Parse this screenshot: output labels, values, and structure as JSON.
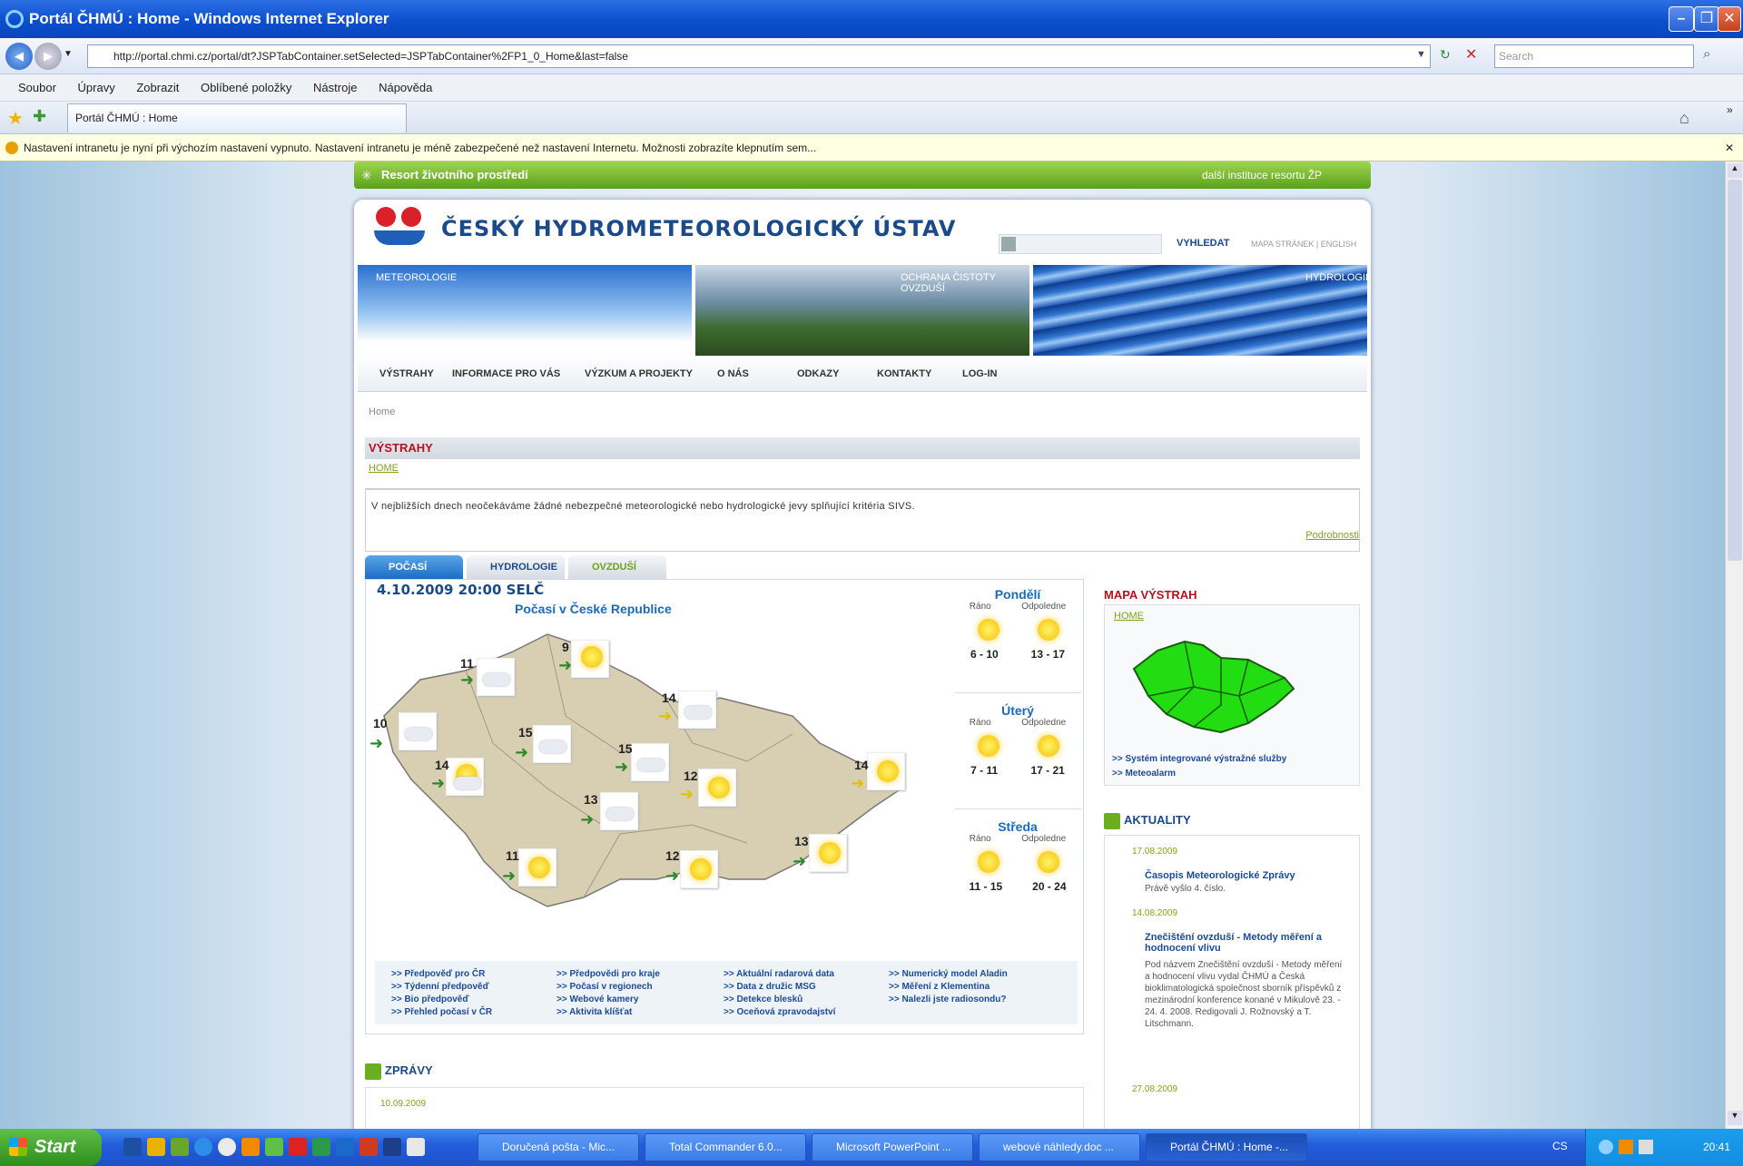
{
  "window": {
    "title": "Portál ČHMÚ : Home - Windows Internet Explorer"
  },
  "addressbar": {
    "url": "http://portal.chmi.cz/portal/dt?JSPTabContainer.setSelected=JSPTabContainer%2FP1_0_Home&last=false",
    "search_placeholder": "Search"
  },
  "menu": [
    "Soubor",
    "Úpravy",
    "Zobrazit",
    "Oblíbené položky",
    "Nástroje",
    "Nápověda"
  ],
  "tab": {
    "label": "Portál ČHMÚ : Home"
  },
  "infobar": {
    "text": "Nastavení intranetu je nyní při výchozím nastavení vypnuto. Nastavení intranetu je méně zabezpečené než nastavení Internetu. Možnosti zobrazíte klepnutím sem..."
  },
  "ministry": {
    "left": "Resort životního prostředí",
    "right": "další instituce resortu ŽP"
  },
  "header": {
    "org_name": "ČESKÝ HYDROMETEOROLOGICKÝ ÚSTAV",
    "search_button": "VYHLEDAT",
    "links": "MAPA STRÁNEK | ENGLISH"
  },
  "banner": {
    "left": "METEOROLOGIE",
    "middle": "OCHRANA ČISTOTY OVZDUŠÍ",
    "right": "HYDROLOGIE"
  },
  "nav": [
    "VÝSTRAHY",
    "INFORMACE PRO VÁS",
    "VÝZKUM A PROJEKTY",
    "O NÁS",
    "ODKAZY",
    "KONTAKTY",
    "LOG-IN"
  ],
  "breadcrumb": "Home",
  "vystrahy": {
    "title": "VÝSTRAHY",
    "home": "HOME",
    "text": "V nejbližších dnech neočekáváme žádné nebezpečné meteorologické nebo hydrologické jevy splňující kritéria SIVS.",
    "details": "Podrobnosti"
  },
  "weather_tabs": [
    "POČASÍ",
    "HYDROLOGIE",
    "OVZDUŠÍ"
  ],
  "weather": {
    "date": "4.10.2009 20:00 SELČ",
    "title": "Počasí v České Republice",
    "temps": [
      "9",
      "11",
      "14",
      "10",
      "15",
      "15",
      "14",
      "12",
      "14",
      "13",
      "11",
      "12",
      "13"
    ],
    "forecast": [
      {
        "day": "Pondělí",
        "morning": "Ráno",
        "afternoon": "Odpoledne",
        "r1": "6 - 10",
        "r2": "13 - 17"
      },
      {
        "day": "Úterý",
        "morning": "Ráno",
        "afternoon": "Odpoledne",
        "r1": "7 - 11",
        "r2": "17 - 21"
      },
      {
        "day": "Středa",
        "morning": "Ráno",
        "afternoon": "Odpoledne",
        "r1": "11 - 15",
        "r2": "20 - 24"
      }
    ],
    "links": [
      [
        ">> Předpověď pro ČR",
        ">> Týdenní předpověď",
        ">> Bio předpověď",
        ">> Přehled počasí v ČR"
      ],
      [
        ">> Předpovědi pro kraje",
        ">> Počasí v regionech",
        ">> Webové kamery",
        ">> Aktivita klíšťat"
      ],
      [
        ">> Aktuální radarová data",
        ">> Data z družic MSG",
        ">> Detekce blesků",
        ">> Oceňová zpravodajství"
      ],
      [
        ">> Numerický model Aladin",
        ">> Měření z Klementina",
        ">> Nalezli jste radiosondu?"
      ]
    ]
  },
  "mapa": {
    "title": "MAPA VÝSTRAH",
    "home": "HOME",
    "links": [
      ">> Systém integrované výstražné služby",
      ">> Meteoalarm"
    ]
  },
  "aktuality": {
    "title": "AKTUALITY",
    "items": [
      {
        "date": "17.08.2009",
        "head": "Časopis Meteorologické Zprávy",
        "text": "Právě vyšlo 4. číslo."
      },
      {
        "date": "14.08.2009",
        "head": "Znečištění ovzduší - Metody měření a hodnocení vlivu",
        "text": "Pod názvem Znečištění ovzduší - Metody měření a hodnocení vlivu vydal ČHMÚ a Česká bioklimatologická společnost sborník příspěvků z mezinárodní konference konané v Mikulově 23. - 24. 4. 2008. Redigovali J. Rožnovský a T. Litschmann."
      },
      {
        "date": "27.08.2009",
        "head": "",
        "text": ""
      }
    ]
  },
  "zpravy": {
    "title": "ZPRÁVY",
    "date": "10.09.2009"
  },
  "taskbar": {
    "start": "Start",
    "items": [
      "Doručená pošta - Mic...",
      "Total Commander 6.0...",
      "Microsoft PowerPoint ...",
      "webové náhledy.doc ...",
      "Portál ČHMÚ : Home -..."
    ],
    "lang": "CS",
    "clock": "20:41"
  }
}
